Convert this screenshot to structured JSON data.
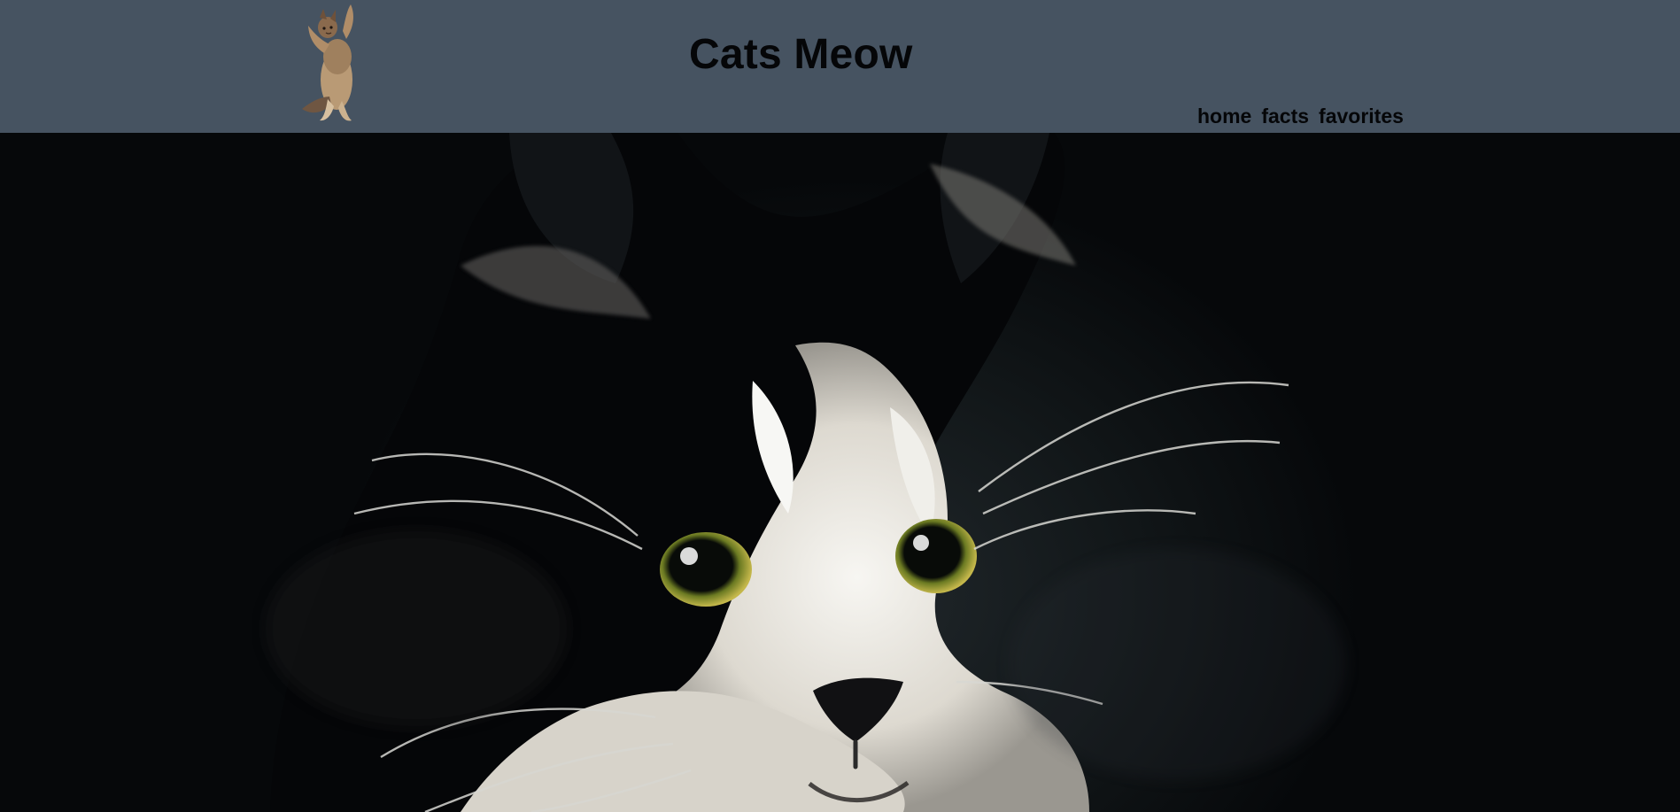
{
  "header": {
    "title": "Cats Meow",
    "logo_icon": "dancing-cat-logo",
    "nav": [
      {
        "label": "home"
      },
      {
        "label": "facts"
      },
      {
        "label": "favorites"
      }
    ]
  },
  "hero": {
    "image": "black-and-white-cat-photo"
  },
  "colors": {
    "header_bg": "#465361",
    "text": "#050608",
    "hero_bg": "#0d1013"
  }
}
